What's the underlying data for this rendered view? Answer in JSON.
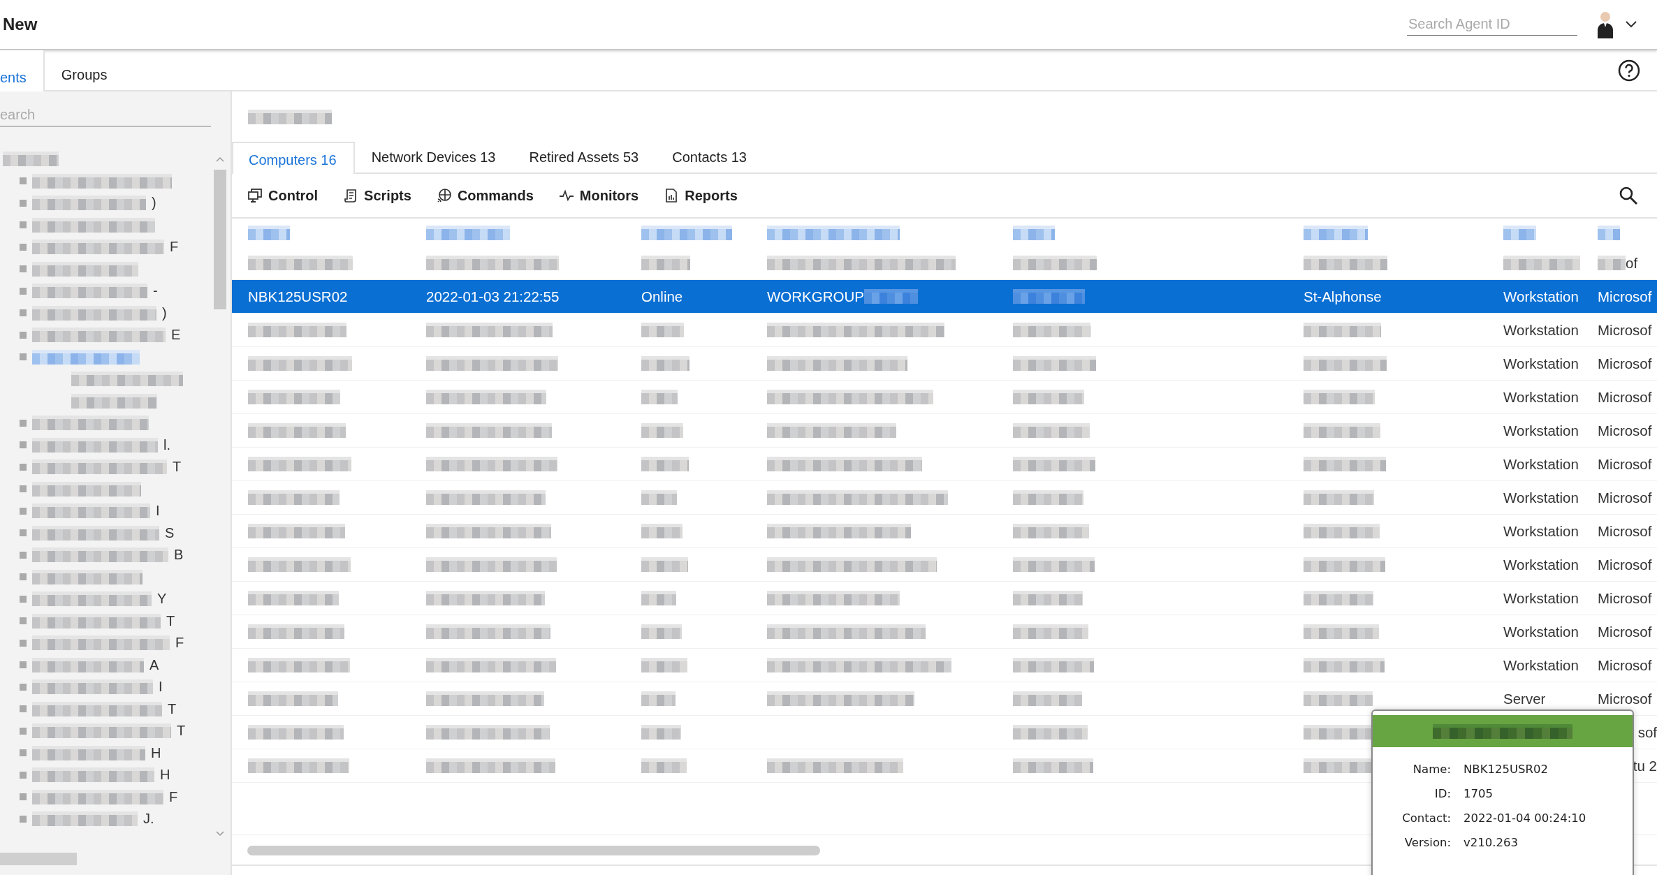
{
  "header": {
    "title": "New",
    "search": {
      "placeholder": "Search Agent ID"
    }
  },
  "tabs": [
    {
      "label": "ents",
      "selected": true
    },
    {
      "label": "Groups",
      "selected": false
    }
  ],
  "sidebar": {
    "search": {
      "placeholder": "earch"
    },
    "tree": {
      "blurred": true,
      "children": [
        {
          "blurred": true,
          "selected": false
        },
        {
          "blurred": true,
          "selected": false,
          "tail": ")"
        },
        {
          "blurred": true,
          "selected": false
        },
        {
          "blurred": true,
          "selected": false,
          "tail": "F"
        },
        {
          "blurred": true,
          "selected": false
        },
        {
          "blurred": true,
          "selected": false,
          "tail": "-"
        },
        {
          "blurred": true,
          "selected": false,
          "tail": ")"
        },
        {
          "blurred": true,
          "selected": false,
          "tail": "E"
        },
        {
          "blurred": true,
          "selected": true,
          "children": [
            {
              "blurred": true,
              "selected": false
            },
            {
              "blurred": true,
              "selected": false
            }
          ]
        },
        {
          "blurred": true,
          "selected": false
        },
        {
          "blurred": true,
          "selected": false,
          "tail": "l."
        },
        {
          "blurred": true,
          "selected": false,
          "tail": "T"
        },
        {
          "blurred": true,
          "selected": false
        },
        {
          "blurred": true,
          "selected": false,
          "tail": "I"
        },
        {
          "blurred": true,
          "selected": false,
          "tail": "S"
        },
        {
          "blurred": true,
          "selected": false,
          "tail": "B"
        },
        {
          "blurred": true,
          "selected": false
        },
        {
          "blurred": true,
          "selected": false,
          "tail": "Y"
        },
        {
          "blurred": true,
          "selected": false,
          "tail": "T"
        },
        {
          "blurred": true,
          "selected": false,
          "tail": "F"
        },
        {
          "blurred": true,
          "selected": false,
          "tail": "A"
        },
        {
          "blurred": true,
          "selected": false,
          "tail": "I"
        },
        {
          "blurred": true,
          "selected": false,
          "tail": "T"
        },
        {
          "blurred": true,
          "selected": false,
          "tail": "T"
        },
        {
          "blurred": true,
          "selected": false,
          "tail": "H"
        },
        {
          "blurred": true,
          "selected": false,
          "tail": "H"
        },
        {
          "blurred": true,
          "selected": false,
          "tail": "F"
        },
        {
          "blurred": true,
          "selected": false,
          "tail": "J."
        }
      ]
    }
  },
  "main": {
    "title": {
      "blurred": true
    },
    "tabs": [
      {
        "label": "Computers 16",
        "selected": true
      },
      {
        "label": "Network Devices 13",
        "selected": false
      },
      {
        "label": "Retired Assets 53",
        "selected": false
      },
      {
        "label": "Contacts 13",
        "selected": false
      }
    ],
    "toolbar": [
      {
        "kind": "control",
        "label": "Control"
      },
      {
        "kind": "scripts",
        "label": "Scripts"
      },
      {
        "kind": "commands",
        "label": "Commands"
      },
      {
        "kind": "monitors",
        "label": "Monitors"
      },
      {
        "kind": "reports",
        "label": "Reports"
      }
    ]
  },
  "table": {
    "columns": [
      {
        "blurred": true
      },
      {
        "blurred": true
      },
      {
        "blurred": true
      },
      {
        "blurred": true
      },
      {
        "blurred": true
      },
      {
        "blurred": true
      },
      {
        "blurred": true
      },
      {
        "blurred": true
      }
    ],
    "rows": [
      {
        "selected": false,
        "cells": [
          {
            "blurred": true
          },
          {
            "blurred": true
          },
          {
            "blurred": true
          },
          {
            "blurred": true
          },
          {
            "blurred": true
          },
          {
            "blurred": true
          },
          {
            "blurred": true
          },
          {
            "blurred": true,
            "tail": "of"
          }
        ]
      },
      {
        "selected": true,
        "cells": [
          "NBK125USR02",
          "2022-01-03 21:22:55",
          "Online",
          {
            "text": "WORKGROUP",
            "blurred": true
          },
          {
            "blurred": true
          },
          "St-Alphonse",
          "Workstation",
          "Microsof"
        ]
      },
      {
        "selected": false,
        "cells": [
          {
            "blurred": true
          },
          {
            "blurred": true
          },
          {
            "blurred": true
          },
          {
            "blurred": true
          },
          {
            "blurred": true
          },
          {
            "blurred": true
          },
          "Workstation",
          "Microsof"
        ]
      },
      {
        "selected": false,
        "cells": [
          {
            "blurred": true
          },
          {
            "blurred": true
          },
          {
            "blurred": true
          },
          {
            "blurred": true
          },
          {
            "blurred": true
          },
          {
            "blurred": true
          },
          "Workstation",
          "Microsof"
        ]
      },
      {
        "selected": false,
        "cells": [
          {
            "blurred": true
          },
          {
            "blurred": true
          },
          {
            "blurred": true
          },
          {
            "blurred": true
          },
          {
            "blurred": true
          },
          {
            "blurred": true
          },
          "Workstation",
          "Microsof"
        ]
      },
      {
        "selected": false,
        "cells": [
          {
            "blurred": true
          },
          {
            "blurred": true
          },
          {
            "blurred": true
          },
          {
            "blurred": true
          },
          {
            "blurred": true
          },
          {
            "blurred": true
          },
          "Workstation",
          "Microsof"
        ]
      },
      {
        "selected": false,
        "cells": [
          {
            "blurred": true
          },
          {
            "blurred": true
          },
          {
            "blurred": true
          },
          {
            "blurred": true
          },
          {
            "blurred": true
          },
          {
            "blurred": true
          },
          "Workstation",
          "Microsof"
        ]
      },
      {
        "selected": false,
        "cells": [
          {
            "blurred": true
          },
          {
            "blurred": true
          },
          {
            "blurred": true
          },
          {
            "blurred": true
          },
          {
            "blurred": true
          },
          {
            "blurred": true
          },
          "Workstation",
          "Microsof"
        ]
      },
      {
        "selected": false,
        "cells": [
          {
            "blurred": true
          },
          {
            "blurred": true
          },
          {
            "blurred": true
          },
          {
            "blurred": true
          },
          {
            "blurred": true
          },
          {
            "blurred": true
          },
          "Workstation",
          "Microsof"
        ]
      },
      {
        "selected": false,
        "cells": [
          {
            "blurred": true
          },
          {
            "blurred": true
          },
          {
            "blurred": true
          },
          {
            "blurred": true
          },
          {
            "blurred": true
          },
          {
            "blurred": true
          },
          "Workstation",
          "Microsof"
        ]
      },
      {
        "selected": false,
        "cells": [
          {
            "blurred": true
          },
          {
            "blurred": true
          },
          {
            "blurred": true
          },
          {
            "blurred": true
          },
          {
            "blurred": true
          },
          {
            "blurred": true
          },
          "Workstation",
          "Microsof"
        ]
      },
      {
        "selected": false,
        "cells": [
          {
            "blurred": true
          },
          {
            "blurred": true
          },
          {
            "blurred": true
          },
          {
            "blurred": true
          },
          {
            "blurred": true
          },
          {
            "blurred": true
          },
          "Workstation",
          "Microsof"
        ]
      },
      {
        "selected": false,
        "cells": [
          {
            "blurred": true
          },
          {
            "blurred": true
          },
          {
            "blurred": true
          },
          {
            "blurred": true
          },
          {
            "blurred": true
          },
          {
            "blurred": true
          },
          "Workstation",
          "Microsof"
        ]
      },
      {
        "selected": false,
        "cells": [
          {
            "blurred": true
          },
          {
            "blurred": true
          },
          {
            "blurred": true
          },
          {
            "blurred": true
          },
          {
            "blurred": true
          },
          {
            "blurred": true
          },
          "Server",
          "Microsof"
        ]
      },
      {
        "selected": false,
        "cells": [
          {
            "blurred": true
          },
          {
            "blurred": true
          },
          {
            "blurred": true
          },
          {
            "blurred": false
          },
          {
            "blurred": true
          },
          {
            "blurred": true
          },
          {
            "text": "sof",
            "covered": true
          }
        ]
      },
      {
        "selected": false,
        "cells": [
          {
            "blurred": true
          },
          {
            "blurred": true
          },
          {
            "blurred": true
          },
          {
            "blurred": true
          },
          {
            "blurred": true
          },
          {
            "blurred": true
          },
          {
            "text": "tu 2",
            "covered": true
          }
        ]
      }
    ]
  },
  "tooltip": {
    "title": {
      "blurred": true
    },
    "fields": [
      {
        "label": "Name:",
        "value": "NBK125USR02"
      },
      {
        "label": "ID:",
        "value": "1705"
      },
      {
        "label": "Contact:",
        "value": "2022-01-04 00:24:10"
      },
      {
        "label": "Version:",
        "value": "v210.263"
      }
    ]
  }
}
